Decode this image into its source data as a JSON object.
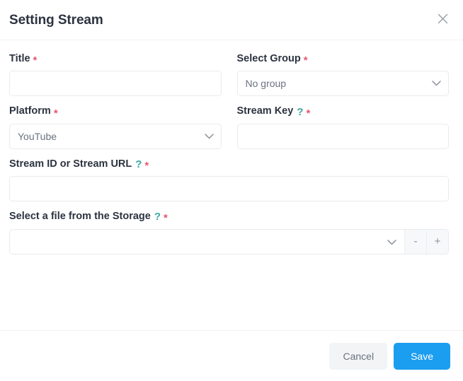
{
  "dialog": {
    "title": "Setting Stream",
    "close_icon": "close-icon"
  },
  "form": {
    "fields": [
      {
        "key": "title",
        "label": "Title",
        "required_mark": "*",
        "has_help": false,
        "control": "text",
        "value": "",
        "placeholder": ""
      },
      {
        "key": "select_group",
        "label": "Select Group",
        "required_mark": "*",
        "has_help": false,
        "control": "select",
        "value": "No group"
      },
      {
        "key": "platform",
        "label": "Platform",
        "required_mark": "*",
        "has_help": false,
        "control": "select",
        "value": "YouTube"
      },
      {
        "key": "stream_key",
        "label": "Stream Key",
        "required_mark": "*",
        "has_help": true,
        "help_mark": "?",
        "control": "text",
        "value": "",
        "placeholder": ""
      },
      {
        "key": "stream_id_or_url",
        "label": "Stream ID or Stream URL",
        "required_mark": "*",
        "has_help": true,
        "help_mark": "?",
        "control": "text",
        "value": "",
        "placeholder": ""
      },
      {
        "key": "storage_file",
        "label": "Select a file from the Storage",
        "required_mark": "*",
        "has_help": true,
        "help_mark": "?",
        "control": "select_stepper",
        "value": "",
        "minus_label": "-",
        "plus_label": "+"
      }
    ]
  },
  "footer": {
    "cancel_label": "Cancel",
    "save_label": "Save"
  },
  "colors": {
    "accent_blue": "#1b9df0",
    "required_red": "#e8576f",
    "help_teal": "#3aa8a0",
    "label_dark": "#2c3340",
    "muted_gray": "#6b7280",
    "border_light": "#e8eaed",
    "cancel_bg": "#f2f4f6"
  }
}
